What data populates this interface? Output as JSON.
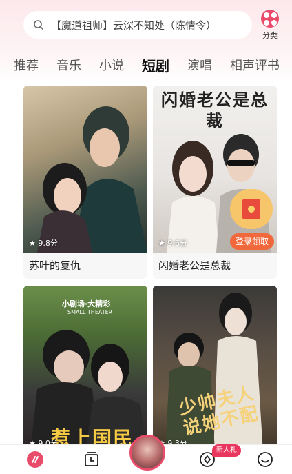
{
  "search": {
    "text": "【魔道祖师】云深不知处（陈情令）"
  },
  "category": {
    "label": "分类"
  },
  "tabs": [
    {
      "label": "推荐"
    },
    {
      "label": "音乐"
    },
    {
      "label": "小说"
    },
    {
      "label": "短剧"
    },
    {
      "label": "演唱"
    },
    {
      "label": "相声评书"
    }
  ],
  "active_tab": "短剧",
  "cards": [
    {
      "title": "苏叶的复仇",
      "rating": "★ 9.8分",
      "cover_text": ""
    },
    {
      "title": "闪婚老公是总裁",
      "rating": "★ 9.6分",
      "cover_text": "闪婚老公是总裁",
      "reward_label": "登录领取"
    },
    {
      "title": "",
      "rating": "★ 9.0分",
      "cover_text": "小剧场·大精彩",
      "cover_sub": "SMALL THEATER",
      "cover_big": "惹上国民"
    },
    {
      "title": "",
      "rating": "★ 9.3分",
      "cover_text": "少帅夫人说她不配"
    }
  ],
  "bottom_nav": {
    "badge": "新人礼"
  },
  "colors": {
    "accent": "#e94b6b",
    "reward": "#f0683b"
  }
}
